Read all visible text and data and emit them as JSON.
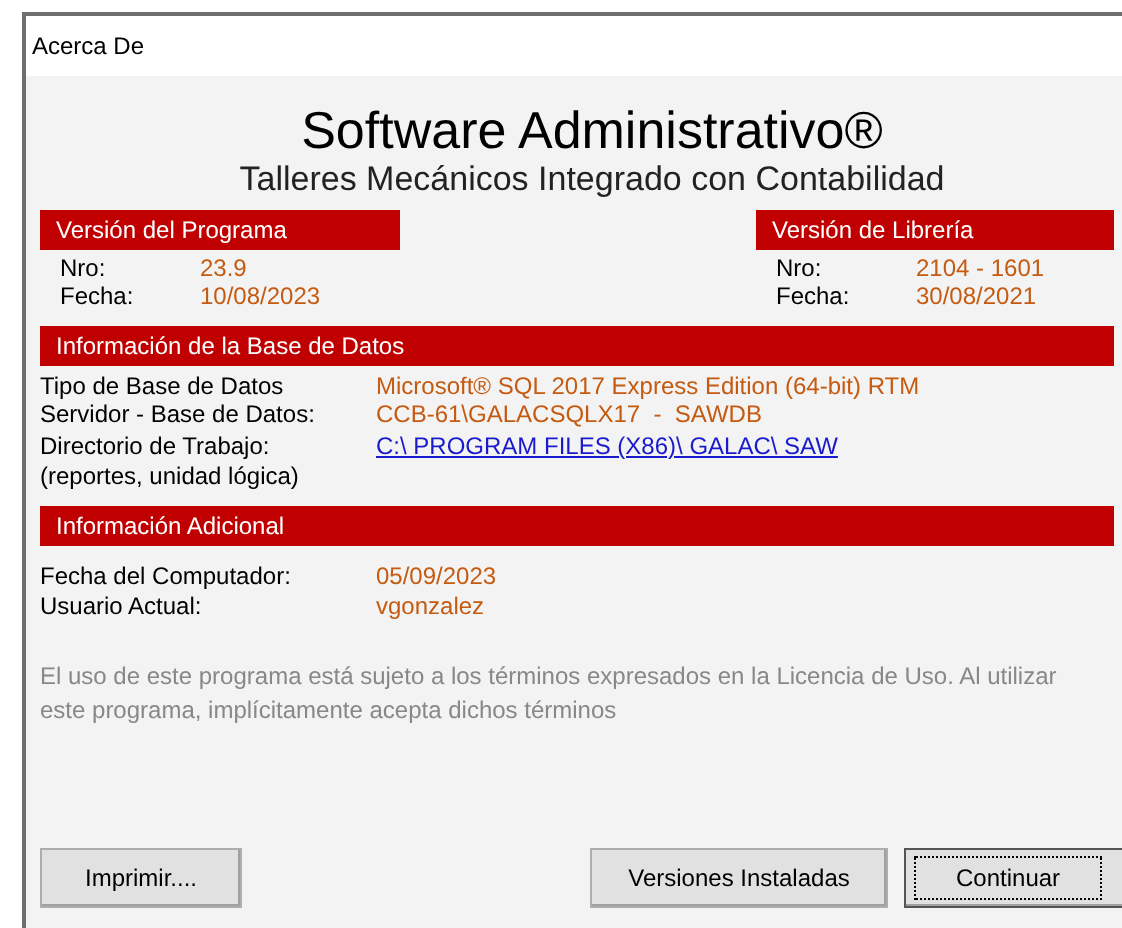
{
  "window": {
    "title": "Acerca De"
  },
  "product": {
    "name": "Software Administrativo®",
    "subtitle": "Talleres Mecánicos Integrado con Contabilidad"
  },
  "program_version": {
    "heading": "Versión del Programa",
    "rows": [
      {
        "label": "Nro:",
        "value": "23.9"
      },
      {
        "label": "Fecha:",
        "value": "10/08/2023"
      }
    ]
  },
  "library_version": {
    "heading": "Versión de Librería",
    "rows": [
      {
        "label": "Nro:",
        "value": "2104 - 1601"
      },
      {
        "label": "Fecha:",
        "value": "30/08/2021"
      }
    ]
  },
  "database": {
    "heading": "Información de la Base de Datos",
    "rows": [
      {
        "label": "Tipo de Base de Datos",
        "value": "Microsoft® SQL 2017 Express Edition (64-bit) RTM",
        "kind": "text"
      },
      {
        "label": "Servidor - Base de Datos:",
        "value": "CCB-61\\GALACSQLX17  -  SAWDB",
        "kind": "text"
      },
      {
        "label": "Directorio de Trabajo:",
        "value": "C:\\ PROGRAM FILES (X86)\\ GALAC\\ SAW",
        "kind": "link"
      },
      {
        "label": "(reportes, unidad lógica)",
        "kind": "note"
      }
    ]
  },
  "additional": {
    "heading": "Información Adicional",
    "rows": [
      {
        "label": "Fecha del Computador:",
        "value": "05/09/2023"
      },
      {
        "label": "Usuario Actual:",
        "value": "vgonzalez"
      }
    ]
  },
  "notice": "El uso de este programa está sujeto a los términos expresados en la Licencia de Uso. Al utilizar este programa, implícitamente acepta dichos términos",
  "buttons": [
    {
      "label": "Imprimir....",
      "default": false
    },
    {
      "label": "Versiones Instaladas",
      "default": false
    },
    {
      "label": "Continuar",
      "default": true
    }
  ]
}
